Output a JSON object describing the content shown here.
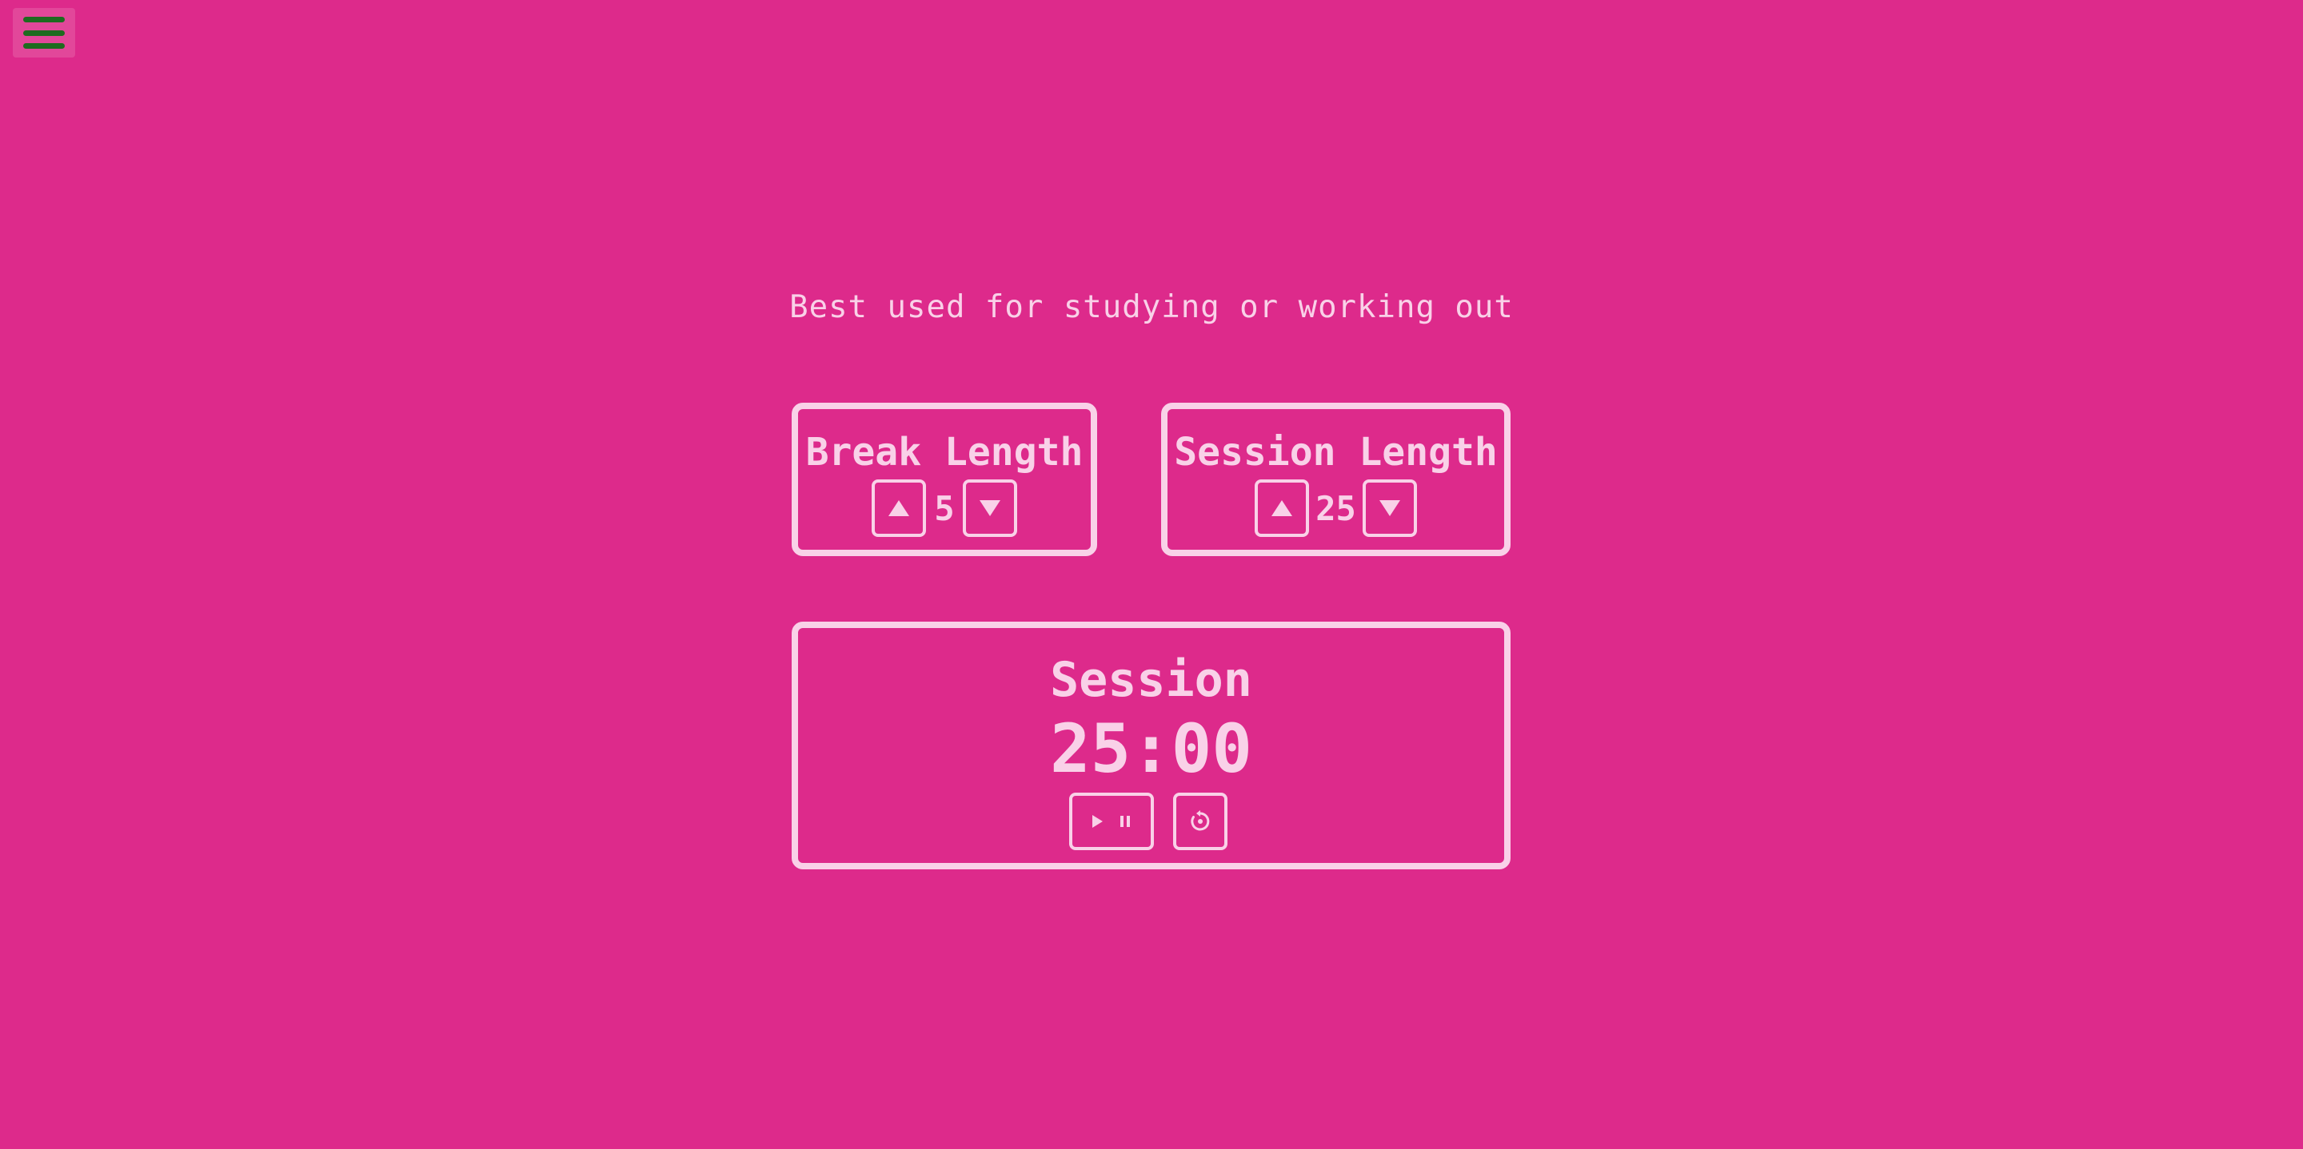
{
  "menu": {
    "icon": "hamburger-menu-icon"
  },
  "tagline": "Best used for studying or working out",
  "break_length": {
    "label": "Break Length",
    "value": "5",
    "increment_icon": "triangle-up-icon",
    "decrement_icon": "triangle-down-icon"
  },
  "session_length": {
    "label": "Session Length",
    "value": "25",
    "increment_icon": "triangle-up-icon",
    "decrement_icon": "triangle-down-icon"
  },
  "timer": {
    "label": "Session",
    "time": "25:00",
    "play_icon": "play-icon",
    "pause_icon": "pause-icon",
    "reset_icon": "reset-icon"
  },
  "colors": {
    "background": "#dd2a8b",
    "foreground": "#f9d1e8",
    "menu_bars": "#1e6b1f"
  }
}
